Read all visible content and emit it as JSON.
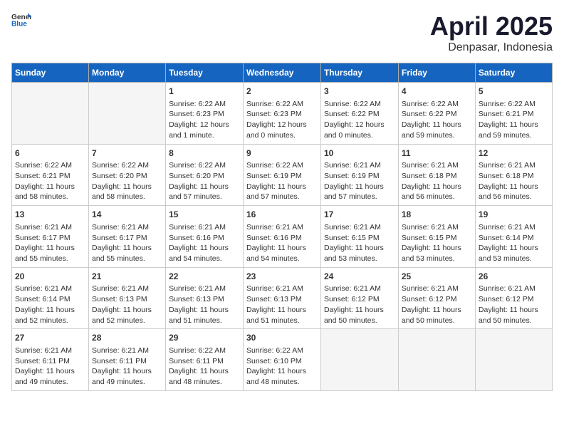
{
  "header": {
    "logo_general": "General",
    "logo_blue": "Blue",
    "title": "April 2025",
    "subtitle": "Denpasar, Indonesia"
  },
  "days_of_week": [
    "Sunday",
    "Monday",
    "Tuesday",
    "Wednesday",
    "Thursday",
    "Friday",
    "Saturday"
  ],
  "weeks": [
    [
      {
        "day": "",
        "text": ""
      },
      {
        "day": "",
        "text": ""
      },
      {
        "day": "1",
        "text": "Sunrise: 6:22 AM\nSunset: 6:23 PM\nDaylight: 12 hours\nand 1 minute."
      },
      {
        "day": "2",
        "text": "Sunrise: 6:22 AM\nSunset: 6:23 PM\nDaylight: 12 hours\nand 0 minutes."
      },
      {
        "day": "3",
        "text": "Sunrise: 6:22 AM\nSunset: 6:22 PM\nDaylight: 12 hours\nand 0 minutes."
      },
      {
        "day": "4",
        "text": "Sunrise: 6:22 AM\nSunset: 6:22 PM\nDaylight: 11 hours\nand 59 minutes."
      },
      {
        "day": "5",
        "text": "Sunrise: 6:22 AM\nSunset: 6:21 PM\nDaylight: 11 hours\nand 59 minutes."
      }
    ],
    [
      {
        "day": "6",
        "text": "Sunrise: 6:22 AM\nSunset: 6:21 PM\nDaylight: 11 hours\nand 58 minutes."
      },
      {
        "day": "7",
        "text": "Sunrise: 6:22 AM\nSunset: 6:20 PM\nDaylight: 11 hours\nand 58 minutes."
      },
      {
        "day": "8",
        "text": "Sunrise: 6:22 AM\nSunset: 6:20 PM\nDaylight: 11 hours\nand 57 minutes."
      },
      {
        "day": "9",
        "text": "Sunrise: 6:22 AM\nSunset: 6:19 PM\nDaylight: 11 hours\nand 57 minutes."
      },
      {
        "day": "10",
        "text": "Sunrise: 6:21 AM\nSunset: 6:19 PM\nDaylight: 11 hours\nand 57 minutes."
      },
      {
        "day": "11",
        "text": "Sunrise: 6:21 AM\nSunset: 6:18 PM\nDaylight: 11 hours\nand 56 minutes."
      },
      {
        "day": "12",
        "text": "Sunrise: 6:21 AM\nSunset: 6:18 PM\nDaylight: 11 hours\nand 56 minutes."
      }
    ],
    [
      {
        "day": "13",
        "text": "Sunrise: 6:21 AM\nSunset: 6:17 PM\nDaylight: 11 hours\nand 55 minutes."
      },
      {
        "day": "14",
        "text": "Sunrise: 6:21 AM\nSunset: 6:17 PM\nDaylight: 11 hours\nand 55 minutes."
      },
      {
        "day": "15",
        "text": "Sunrise: 6:21 AM\nSunset: 6:16 PM\nDaylight: 11 hours\nand 54 minutes."
      },
      {
        "day": "16",
        "text": "Sunrise: 6:21 AM\nSunset: 6:16 PM\nDaylight: 11 hours\nand 54 minutes."
      },
      {
        "day": "17",
        "text": "Sunrise: 6:21 AM\nSunset: 6:15 PM\nDaylight: 11 hours\nand 53 minutes."
      },
      {
        "day": "18",
        "text": "Sunrise: 6:21 AM\nSunset: 6:15 PM\nDaylight: 11 hours\nand 53 minutes."
      },
      {
        "day": "19",
        "text": "Sunrise: 6:21 AM\nSunset: 6:14 PM\nDaylight: 11 hours\nand 53 minutes."
      }
    ],
    [
      {
        "day": "20",
        "text": "Sunrise: 6:21 AM\nSunset: 6:14 PM\nDaylight: 11 hours\nand 52 minutes."
      },
      {
        "day": "21",
        "text": "Sunrise: 6:21 AM\nSunset: 6:13 PM\nDaylight: 11 hours\nand 52 minutes."
      },
      {
        "day": "22",
        "text": "Sunrise: 6:21 AM\nSunset: 6:13 PM\nDaylight: 11 hours\nand 51 minutes."
      },
      {
        "day": "23",
        "text": "Sunrise: 6:21 AM\nSunset: 6:13 PM\nDaylight: 11 hours\nand 51 minutes."
      },
      {
        "day": "24",
        "text": "Sunrise: 6:21 AM\nSunset: 6:12 PM\nDaylight: 11 hours\nand 50 minutes."
      },
      {
        "day": "25",
        "text": "Sunrise: 6:21 AM\nSunset: 6:12 PM\nDaylight: 11 hours\nand 50 minutes."
      },
      {
        "day": "26",
        "text": "Sunrise: 6:21 AM\nSunset: 6:12 PM\nDaylight: 11 hours\nand 50 minutes."
      }
    ],
    [
      {
        "day": "27",
        "text": "Sunrise: 6:21 AM\nSunset: 6:11 PM\nDaylight: 11 hours\nand 49 minutes."
      },
      {
        "day": "28",
        "text": "Sunrise: 6:21 AM\nSunset: 6:11 PM\nDaylight: 11 hours\nand 49 minutes."
      },
      {
        "day": "29",
        "text": "Sunrise: 6:22 AM\nSunset: 6:11 PM\nDaylight: 11 hours\nand 48 minutes."
      },
      {
        "day": "30",
        "text": "Sunrise: 6:22 AM\nSunset: 6:10 PM\nDaylight: 11 hours\nand 48 minutes."
      },
      {
        "day": "",
        "text": ""
      },
      {
        "day": "",
        "text": ""
      },
      {
        "day": "",
        "text": ""
      }
    ]
  ]
}
